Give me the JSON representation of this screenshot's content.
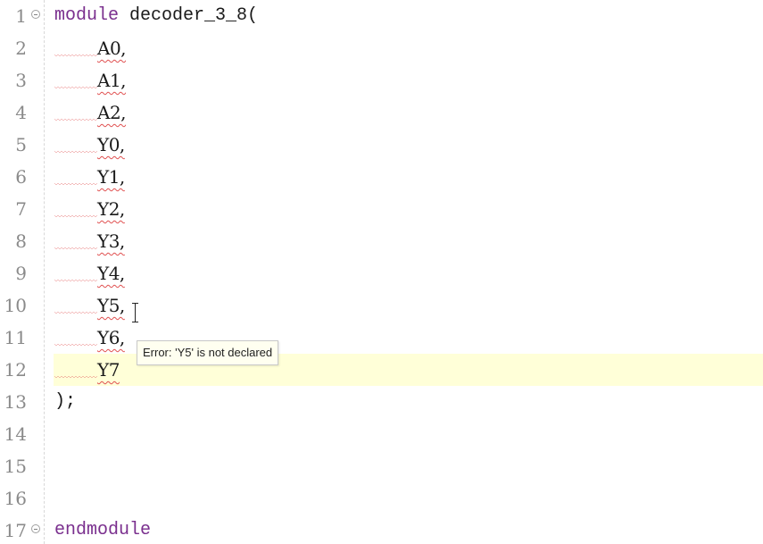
{
  "editor": {
    "lines": [
      {
        "num": "1",
        "fold": true,
        "parts": [
          {
            "t": "module",
            "cls": "kw"
          },
          {
            "t": " decoder_3_8(",
            "cls": ""
          }
        ]
      },
      {
        "num": "2",
        "sig": "A0,"
      },
      {
        "num": "3",
        "sig": "A1,"
      },
      {
        "num": "4",
        "sig": "A2,"
      },
      {
        "num": "5",
        "sig": "Y0,"
      },
      {
        "num": "6",
        "sig": "Y1,"
      },
      {
        "num": "7",
        "sig": "Y2,"
      },
      {
        "num": "8",
        "sig": "Y3,"
      },
      {
        "num": "9",
        "sig": "Y4,"
      },
      {
        "num": "10",
        "sig": "Y5,"
      },
      {
        "num": "11",
        "sig": "Y6,"
      },
      {
        "num": "12",
        "sig": "Y7",
        "current": true
      },
      {
        "num": "13",
        "parts": [
          {
            "t": ");",
            "cls": ""
          }
        ]
      },
      {
        "num": "14",
        "parts": []
      },
      {
        "num": "15",
        "parts": []
      },
      {
        "num": "16",
        "parts": []
      },
      {
        "num": "17",
        "fold": true,
        "parts": [
          {
            "t": "endmodule",
            "cls": "kw"
          }
        ]
      }
    ],
    "current_line": 12
  },
  "tooltip": {
    "text": "Error: 'Y5' is not declared"
  },
  "colors": {
    "keyword": "#7a2f8e",
    "current_line_bg": "#ffffd8",
    "error_squiggle": "#e05050",
    "line_number": "#8a8a8a"
  }
}
